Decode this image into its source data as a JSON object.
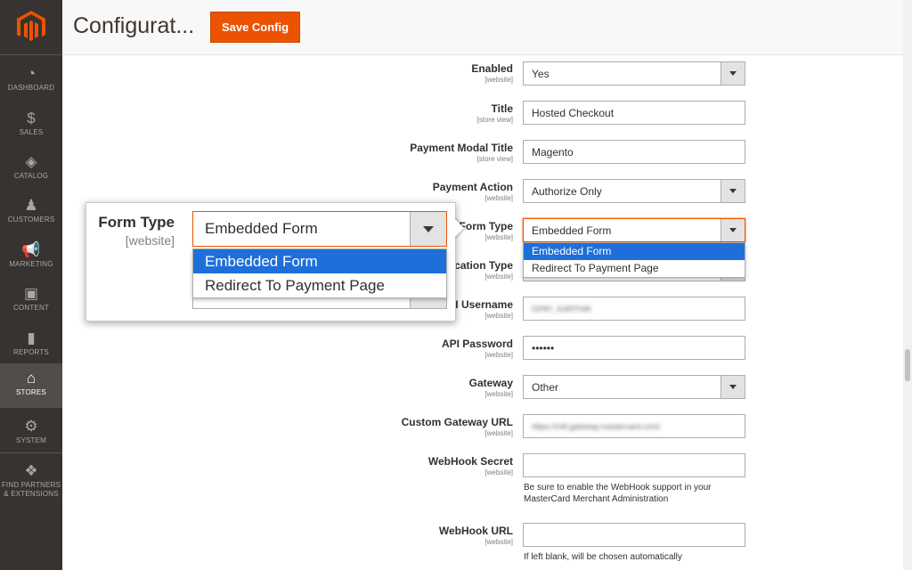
{
  "sidebar": {
    "logo": "magento-logo",
    "items": [
      {
        "label": "DASHBOARD",
        "icon": "speedometer-icon",
        "glyph": "◔"
      },
      {
        "label": "SALES",
        "icon": "dollar-icon",
        "glyph": "$"
      },
      {
        "label": "CATALOG",
        "icon": "box-icon",
        "glyph": "◈"
      },
      {
        "label": "CUSTOMERS",
        "icon": "person-icon",
        "glyph": "♟"
      },
      {
        "label": "MARKETING",
        "icon": "megaphone-icon",
        "glyph": "📢"
      },
      {
        "label": "CONTENT",
        "icon": "layout-icon",
        "glyph": "▣"
      },
      {
        "label": "REPORTS",
        "icon": "bar-chart-icon",
        "glyph": "▮"
      },
      {
        "label": "STORES",
        "icon": "store-icon",
        "glyph": "⌂"
      },
      {
        "label": "SYSTEM",
        "icon": "gear-icon",
        "glyph": "⚙"
      },
      {
        "label": "FIND PARTNERS",
        "label2": "& EXTENSIONS",
        "icon": "cubes-icon",
        "glyph": "❖"
      }
    ],
    "active": "STORES"
  },
  "header": {
    "title": "Configurat...",
    "save_label": "Save Config"
  },
  "form": {
    "enabled": {
      "label": "Enabled",
      "scope": "[website]",
      "value": "Yes"
    },
    "title": {
      "label": "Title",
      "scope": "[store view]",
      "value": "Hosted Checkout"
    },
    "modal_title": {
      "label": "Payment Modal Title",
      "scope": "[store view]",
      "value": "Magento"
    },
    "payment_action": {
      "label": "Payment Action",
      "scope": "[website]",
      "value": "Authorize Only"
    },
    "form_type": {
      "label": "Form Type",
      "scope": "[website]",
      "value": "Embedded Form",
      "options": [
        "Embedded Form",
        "Redirect To Payment Page"
      ]
    },
    "integration_type": {
      "label": "cation Type",
      "scope": "[website]"
    },
    "api_username": {
      "label": "I Username",
      "scope": "[website]",
      "value": "GPAY_KARTHIK"
    },
    "api_password": {
      "label": "API Password",
      "scope": "[website]",
      "value": "••••••"
    },
    "gateway": {
      "label": "Gateway",
      "scope": "[website]",
      "value": "Other"
    },
    "custom_gateway_url": {
      "label": "Custom Gateway URL",
      "scope": "[website]",
      "value": "https://mtf.gateway.mastercard.com/"
    },
    "webhook_secret": {
      "label": "WebHook Secret",
      "scope": "[website]",
      "value": "",
      "note": "Be sure to enable the WebHook support in your MasterCard Merchant Administration"
    },
    "webhook_url": {
      "label": "WebHook URL",
      "scope": "[website]",
      "value": "",
      "note": "If left blank, will be chosen automatically"
    }
  },
  "zoom": {
    "label": "Form Type",
    "scope": "[website]",
    "value": "Embedded Form",
    "options": [
      "Embedded Form",
      "Redirect To Payment Page"
    ]
  },
  "colors": {
    "accent": "#eb5202",
    "sidebar": "#373330",
    "selected_option": "#1e6fd9"
  }
}
